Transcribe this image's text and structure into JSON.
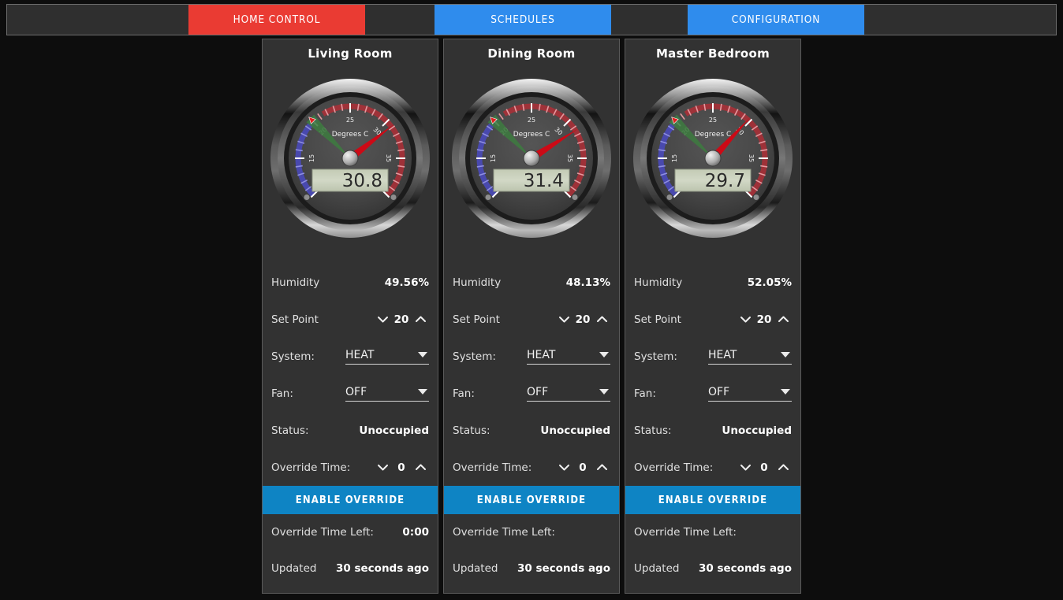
{
  "tabs": [
    {
      "label": "HOME CONTROL",
      "state": "active",
      "color": "#ea3b33"
    },
    {
      "label": "SCHEDULES",
      "state": "inactive",
      "color": "#2f8ced"
    },
    {
      "label": "CONFIGURATION",
      "state": "inactive",
      "color": "#2f8ced"
    }
  ],
  "gauge_common": {
    "unit_label": "Degrees C",
    "min": 10,
    "max": 40,
    "ticks": [
      10,
      15,
      20,
      25,
      30,
      35,
      40
    ],
    "low_arc_color": "#4a4ab4",
    "high_arc_color": "#a33038",
    "setpoint_band_color": "#3d7a40",
    "needle_color": "#cc0a16",
    "readout_bg": "#cdd4bf",
    "readout_fg": "#2a2a2a"
  },
  "labels": {
    "humidity": "Humidity",
    "set_point": "Set Point",
    "system": "System:",
    "fan": "Fan:",
    "status": "Status:",
    "override_time": "Override Time:",
    "enable_override": "ENABLE OVERRIDE",
    "override_time_left": "Override Time Left:",
    "updated": "Updated"
  },
  "accent": {
    "button_blue": "#0e84c4",
    "panel_bg": "#323232",
    "panel_border": "#5a5a5a",
    "page_bg": "#0d0d0d",
    "tabbar_bg": "#2f2f2f"
  },
  "panels": [
    {
      "title": "Living Room",
      "temperature": "30.8",
      "temperature_value": 30.8,
      "setpoint_value": 20,
      "humidity": "49.56%",
      "set_point": "20",
      "system": "HEAT",
      "fan": "OFF",
      "status": "Unoccupied",
      "override_time": "0",
      "override_time_left": "0:00",
      "updated": "30 seconds ago"
    },
    {
      "title": "Dining Room",
      "temperature": "31.4",
      "temperature_value": 31.4,
      "setpoint_value": 20,
      "humidity": "48.13%",
      "set_point": "20",
      "system": "HEAT",
      "fan": "OFF",
      "status": "Unoccupied",
      "override_time": "0",
      "override_time_left": "",
      "updated": "30 seconds ago"
    },
    {
      "title": "Master Bedroom",
      "temperature": "29.7",
      "temperature_value": 29.7,
      "setpoint_value": 20,
      "humidity": "52.05%",
      "set_point": "20",
      "system": "HEAT",
      "fan": "OFF",
      "status": "Unoccupied",
      "override_time": "0",
      "override_time_left": "",
      "updated": "30 seconds ago"
    }
  ]
}
